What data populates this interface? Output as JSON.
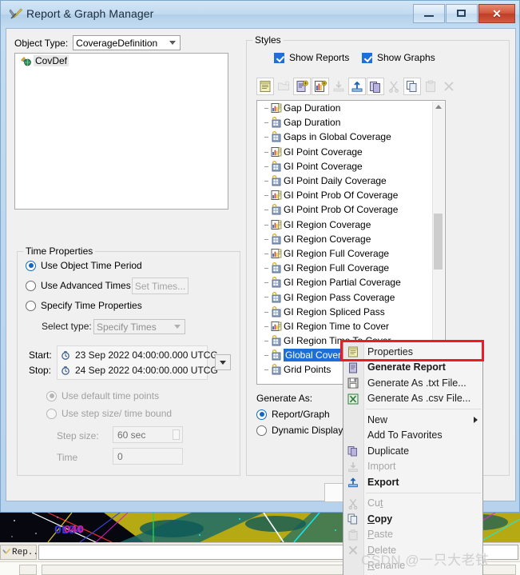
{
  "window": {
    "title": "Report & Graph Manager",
    "icon": "wrench-pencil-icon",
    "minimize_label": "Minimize",
    "maximize_label": "Maximize",
    "close_label": "Close"
  },
  "left": {
    "object_type_label": "Object Type:",
    "object_type_value": "CoverageDefinition",
    "object_list": [
      {
        "label": "CovDef",
        "icon": "coverage-definition-icon",
        "selected": true
      }
    ]
  },
  "time_properties": {
    "legend": "Time Properties",
    "use_object_time_period": "Use Object Time Period",
    "use_advanced_times": "Use Advanced Times",
    "set_times_button": "Set Times...",
    "specify_time_properties": "Specify Time Properties",
    "select_type_label": "Select type:",
    "select_type_value": "Specify Times",
    "start_label": "Start:",
    "start_value": "23 Sep 2022 04:00:00.000 UTCG",
    "stop_label": "Stop:",
    "stop_value": "24 Sep 2022 04:00:00.000 UTCG",
    "use_default_time_points": "Use default time points",
    "use_step_size_time_bound": "Use step size/ time bound",
    "step_size_label": "Step size:",
    "step_size_value": "60 sec",
    "time_label": "Time",
    "time_value": "0"
  },
  "styles": {
    "legend": "Styles",
    "show_reports": "Show Reports",
    "show_graphs": "Show Graphs",
    "toolbar": [
      {
        "name": "report-properties-icon",
        "enabled": true
      },
      {
        "name": "new-folder-icon",
        "enabled": false
      },
      {
        "name": "new-report-icon",
        "enabled": true
      },
      {
        "name": "new-graph-icon",
        "enabled": true
      },
      {
        "name": "import-icon",
        "enabled": false
      },
      {
        "name": "export-icon",
        "enabled": true
      },
      {
        "name": "duplicate-icon",
        "enabled": true
      },
      {
        "name": "cut-icon",
        "enabled": false
      },
      {
        "name": "copy-icon",
        "enabled": true
      },
      {
        "name": "paste-icon",
        "enabled": false
      },
      {
        "name": "delete-icon",
        "enabled": false
      }
    ],
    "items": [
      {
        "label": "Gap Duration",
        "icon": "graph-style-icon"
      },
      {
        "label": "Gap Duration",
        "icon": "report-style-icon"
      },
      {
        "label": "Gaps in Global Coverage",
        "icon": "report-style-icon"
      },
      {
        "label": "GI Point Coverage",
        "icon": "graph-style-icon"
      },
      {
        "label": "GI Point Coverage",
        "icon": "report-style-icon"
      },
      {
        "label": "GI Point Daily Coverage",
        "icon": "report-style-icon"
      },
      {
        "label": "GI Point Prob Of Coverage",
        "icon": "graph-style-icon"
      },
      {
        "label": "GI Point Prob Of Coverage",
        "icon": "report-style-icon"
      },
      {
        "label": "GI Region Coverage",
        "icon": "graph-style-icon"
      },
      {
        "label": "GI Region Coverage",
        "icon": "report-style-icon"
      },
      {
        "label": "GI Region Full Coverage",
        "icon": "graph-style-icon"
      },
      {
        "label": "GI Region Full Coverage",
        "icon": "report-style-icon"
      },
      {
        "label": "GI Region Partial Coverage",
        "icon": "report-style-icon"
      },
      {
        "label": "GI Region Pass Coverage",
        "icon": "report-style-icon"
      },
      {
        "label": "GI Region Spliced Pass",
        "icon": "report-style-icon"
      },
      {
        "label": "GI Region Time to Cover",
        "icon": "graph-style-icon"
      },
      {
        "label": "GI Region Time To Cover",
        "icon": "report-style-icon"
      },
      {
        "label": "Global Coverage",
        "icon": "report-style-icon",
        "selected": true
      },
      {
        "label": "Grid Points",
        "icon": "report-style-icon"
      }
    ],
    "generate_as_label": "Generate As:",
    "generate_report_graph": "Report/Graph",
    "generate_dynamic": "Dynamic Display/Str"
  },
  "context_menu": {
    "items": [
      {
        "label": "Properties",
        "icon": "properties-icon",
        "bold": false,
        "disabled": false,
        "highlighted": true
      },
      {
        "label": "Generate Report",
        "icon": "generate-report-icon",
        "bold": true,
        "disabled": false
      },
      {
        "label": "Generate As .txt File...",
        "icon": "save-txt-icon",
        "bold": false,
        "disabled": false
      },
      {
        "label": "Generate As .csv File...",
        "icon": "save-csv-icon",
        "bold": false,
        "disabled": false
      },
      {
        "separator": true
      },
      {
        "label": "New",
        "icon": "",
        "bold": false,
        "disabled": false,
        "submenu": true
      },
      {
        "label": "Add To Favorites",
        "icon": "",
        "bold": false,
        "disabled": false
      },
      {
        "label": "Duplicate",
        "icon": "duplicate-icon",
        "bold": false,
        "disabled": false
      },
      {
        "label": "Import",
        "icon": "import-icon",
        "bold": false,
        "disabled": true
      },
      {
        "label": "Export",
        "icon": "export-icon",
        "bold": true,
        "disabled": false
      },
      {
        "separator": true
      },
      {
        "label": "Cut",
        "icon": "cut-icon",
        "bold": false,
        "disabled": true,
        "accel": "t"
      },
      {
        "label": "Copy",
        "icon": "copy-icon",
        "bold": true,
        "disabled": false,
        "accel": "C"
      },
      {
        "label": "Paste",
        "icon": "paste-icon",
        "bold": false,
        "disabled": true,
        "accel": "P"
      },
      {
        "label": "Delete",
        "icon": "delete-icon",
        "bold": false,
        "disabled": true,
        "accel": "D"
      },
      {
        "label": "Rename",
        "icon": "",
        "bold": false,
        "disabled": true,
        "accel": "R"
      }
    ]
  },
  "taskbar": {
    "button_label": "Rep..."
  },
  "watermark": "CSDN @一只大老铁",
  "colors": {
    "accent_blue": "#1c6ed8",
    "highlight_red": "#ef1b24",
    "title_gradient_top": "#d4e6f6",
    "close_button_red": "#d2563c"
  }
}
